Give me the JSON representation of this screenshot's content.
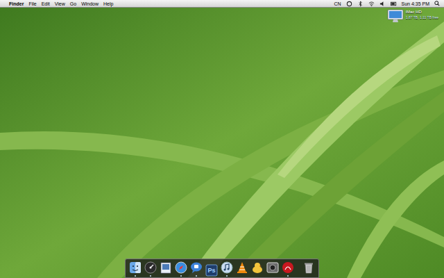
{
  "menu_bar": {
    "apple": "",
    "app": "Finder",
    "menus": [
      "File",
      "Edit",
      "View",
      "Go",
      "Window",
      "Help"
    ],
    "input_source": "CN",
    "status_icons": [
      {
        "kind": "sync"
      },
      {
        "kind": "bluetooth"
      },
      {
        "kind": "wifi"
      },
      {
        "kind": "volume"
      },
      {
        "kind": "battery"
      }
    ],
    "clock": "Sun 4:35 PM"
  },
  "desktop_icons": [
    {
      "label": "iMac HD",
      "detail": "1.87 TB, 1.11 TB free"
    }
  ],
  "dock": {
    "items": [
      {
        "kind": "finder",
        "running": true,
        "label": ""
      },
      {
        "kind": "dashboard",
        "running": true,
        "label": ""
      },
      {
        "kind": "preview",
        "running": false,
        "label": ""
      },
      {
        "kind": "safari",
        "running": true,
        "label": ""
      },
      {
        "kind": "ichat",
        "running": true,
        "label": ""
      },
      {
        "kind": "photoshop",
        "running": false,
        "label": "Ps"
      },
      {
        "kind": "itunes",
        "running": true,
        "label": ""
      },
      {
        "kind": "vlc",
        "running": false,
        "label": ""
      },
      {
        "kind": "adium",
        "running": false,
        "label": ""
      },
      {
        "kind": "photobooth",
        "running": false,
        "label": ""
      },
      {
        "kind": "acrobat",
        "running": true,
        "label": ""
      },
      {
        "kind": "separator",
        "running": false,
        "label": ""
      },
      {
        "kind": "trash",
        "running": false,
        "label": ""
      }
    ]
  }
}
